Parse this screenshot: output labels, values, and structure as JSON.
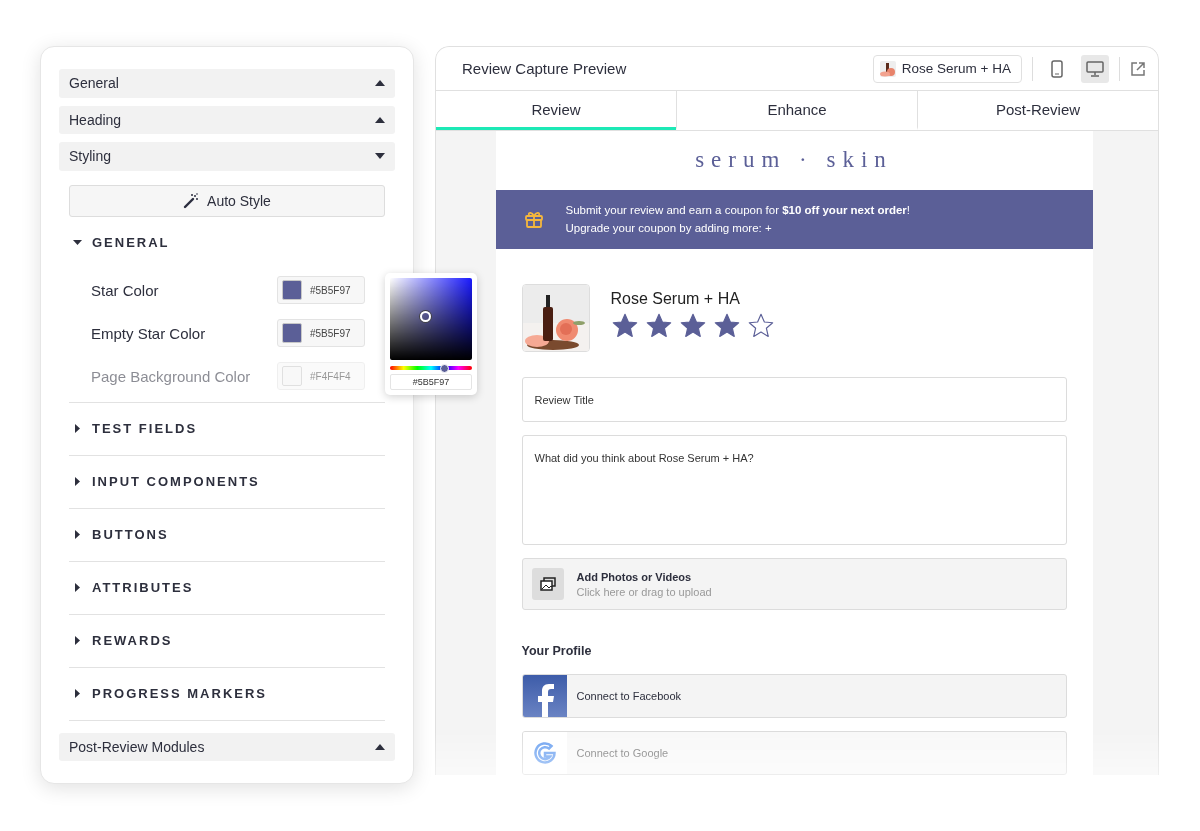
{
  "settings": {
    "sections_top": [
      {
        "label": "General",
        "expanded": false
      },
      {
        "label": "Heading",
        "expanded": false
      },
      {
        "label": "Styling",
        "expanded": true
      }
    ],
    "auto_style": "Auto Style",
    "groups": [
      {
        "label": "GENERAL",
        "expanded": true,
        "rows": [
          {
            "label": "Star Color",
            "color": "#5b5f97",
            "value": "#5B5F97"
          },
          {
            "label": "Empty Star Color",
            "color": "#5b5f97",
            "value": "#5B5F97"
          },
          {
            "label": "Page Background Color",
            "color": "#f4f4f4",
            "value": "#F4F4F4"
          }
        ]
      },
      {
        "label": "TEST FIELDS",
        "expanded": false
      },
      {
        "label": "INPUT COMPONENTS",
        "expanded": false
      },
      {
        "label": "BUTTONS",
        "expanded": false
      },
      {
        "label": "ATTRIBUTES",
        "expanded": false
      },
      {
        "label": "REWARDS",
        "expanded": false
      },
      {
        "label": "PROGRESS MARKERS",
        "expanded": false
      }
    ],
    "sections_bottom": [
      {
        "label": "Post-Review Modules",
        "expanded": false
      }
    ],
    "color_picker": {
      "value": "#5B5F97",
      "hue": {
        "level": 0.66
      }
    }
  },
  "preview": {
    "title": "Review Capture Preview",
    "product_chip": "Rose Serum + HA",
    "devices": [
      {
        "kind": "phone",
        "selected": false
      },
      {
        "kind": "desktop",
        "selected": true
      }
    ],
    "tabs": [
      {
        "label": "Review",
        "selected": true
      },
      {
        "label": "Enhance",
        "selected": false
      },
      {
        "label": "Post-Review",
        "selected": false
      }
    ],
    "logo": "serum · skin",
    "banner": [
      "Submit your review and earn a coupon for **$10 off your next order**!",
      "Upgrade your coupon by adding more: +"
    ],
    "product": {
      "name": "Rose Serum + HA",
      "stars": 4
    },
    "review_title": {
      "placeholder": "Review Title"
    },
    "review_body": {
      "placeholder": "What did you think about Rose Serum + HA?"
    },
    "upload": {
      "title": "Add Photos or Videos",
      "hint": "Click here or drag to upload"
    },
    "profile_heading": "Your Profile",
    "connect": [
      {
        "kind": "facebook",
        "label": "Connect to Facebook"
      },
      {
        "kind": "google",
        "label": "Connect to Google"
      }
    ]
  }
}
